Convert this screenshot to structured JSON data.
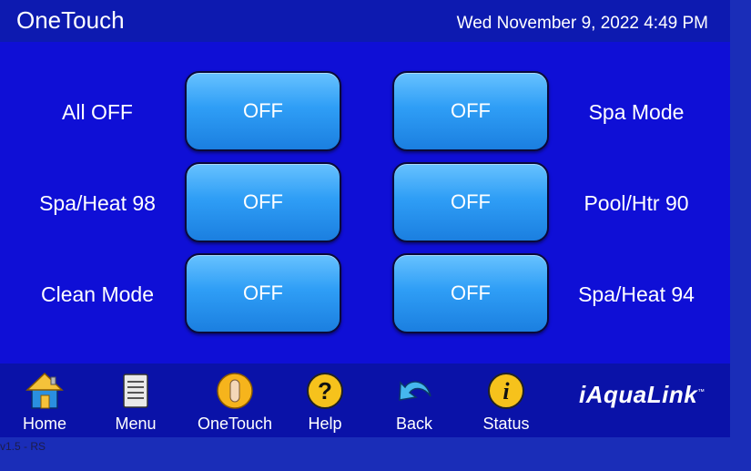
{
  "header": {
    "title": "OneTouch",
    "datetime": "Wed November 9, 2022 4:49 PM"
  },
  "rows": [
    {
      "left_label": "All OFF",
      "left_button": "OFF",
      "right_button": "OFF",
      "right_label": "Spa Mode"
    },
    {
      "left_label": "Spa/Heat 98",
      "left_button": "OFF",
      "right_button": "OFF",
      "right_label": "Pool/Htr 90"
    },
    {
      "left_label": "Clean Mode",
      "left_button": "OFF",
      "right_button": "OFF",
      "right_label": "Spa/Heat 94"
    }
  ],
  "nav": {
    "home": "Home",
    "menu": "Menu",
    "onetouch": "OneTouch",
    "help": "Help",
    "back": "Back",
    "status": "Status"
  },
  "nav_icons": [
    "home-icon",
    "menu-icon",
    "onetouch-icon",
    "help-icon",
    "back-icon",
    "status-icon"
  ],
  "brand": {
    "name": "iAquaLink",
    "tm": "™"
  },
  "version": "v1.5 - RS",
  "colors": {
    "panel": "#0f0fd6",
    "header": "#0d1ab0",
    "footer": "#0a12a8",
    "button": "#2f9ef6",
    "text": "#ffffff"
  }
}
